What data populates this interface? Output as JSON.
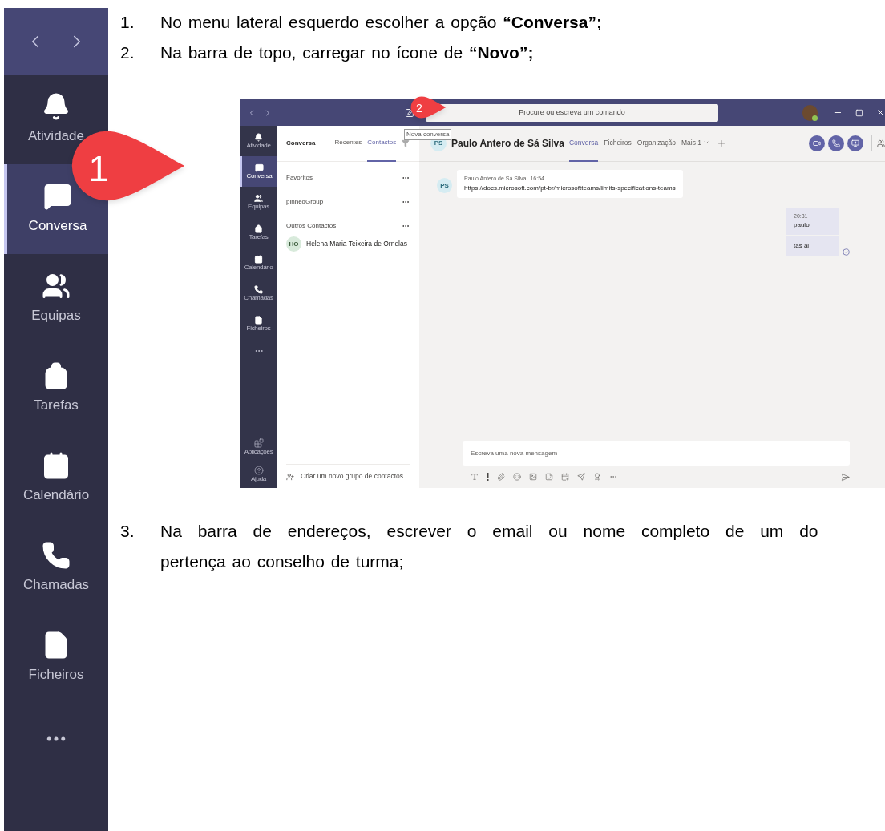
{
  "sidebar": {
    "items": [
      {
        "label": "Atividade",
        "selected": false
      },
      {
        "label": "Conversa",
        "selected": true
      },
      {
        "label": "Equipas",
        "selected": false
      },
      {
        "label": "Tarefas",
        "selected": false
      },
      {
        "label": "Calendário",
        "selected": false
      },
      {
        "label": "Chamadas",
        "selected": false
      },
      {
        "label": "Ficheiros",
        "selected": false
      }
    ]
  },
  "steps": [
    {
      "number": "1.",
      "lines": [
        "No menu lateral esquerdo escolher a opção **“Conversa”;**"
      ]
    },
    {
      "number": "2.",
      "lines": [
        "Na barra de topo, carregar no ícone de **“Novo”;**"
      ]
    }
  ],
  "callouts": [
    "1",
    "2"
  ],
  "teams_window": {
    "search": {
      "placeholder": "Procure ou escreva um comando"
    },
    "tooltip": "Nova conversa",
    "rail": {
      "items": [
        {
          "label": "Atividade",
          "selected": false
        },
        {
          "label": "Conversa",
          "selected": true
        },
        {
          "label": "Equipas",
          "selected": false
        },
        {
          "label": "Tarefas",
          "selected": false
        },
        {
          "label": "Calendário",
          "selected": false
        },
        {
          "label": "Chamadas",
          "selected": false
        },
        {
          "label": "Ficheiros",
          "selected": false
        }
      ],
      "bottom_items": [
        {
          "label": "Aplicações"
        },
        {
          "label": "Ajuda"
        }
      ]
    },
    "list_panel": {
      "title": "Conversa",
      "tabs": [
        {
          "label": "Recentes",
          "selected": false
        },
        {
          "label": "Contactos",
          "selected": true
        }
      ],
      "groups": [
        {
          "name": "Favoritos"
        },
        {
          "name": "pinnedGroup"
        },
        {
          "name": "Outros Contactos",
          "contacts": [
            {
              "initials": "HO",
              "name": "Helena Maria Teixeira de Ornelas"
            }
          ]
        }
      ],
      "footer": "Criar um novo grupo de contactos"
    },
    "chat": {
      "initials": "PS",
      "name": "Paulo Antero de Sá Silva",
      "tabs": [
        {
          "label": "Conversa",
          "selected": true
        },
        {
          "label": "Ficheiros",
          "selected": false
        },
        {
          "label": "Organização",
          "selected": false
        },
        {
          "label": "Mais 1",
          "selected": false
        }
      ],
      "incoming": [
        {
          "initials": "PS",
          "author": "Paulo Antero de Sá Silva",
          "time": "16:54",
          "text": "https://docs.microsoft.com/pt-br/microsoftteams/limits-specifications-teams"
        }
      ],
      "outgoing": [
        {
          "time": "20:31",
          "text": "paulo"
        },
        {
          "text": "tas ai"
        }
      ],
      "compose": {
        "placeholder": "Escreva uma nova mensagem"
      }
    }
  },
  "step3": {
    "number": "3.",
    "lines": [
      "Na barra de endereços, escrever o email ou nome completo de um do",
      "pertença ao conselho de turma;"
    ]
  }
}
